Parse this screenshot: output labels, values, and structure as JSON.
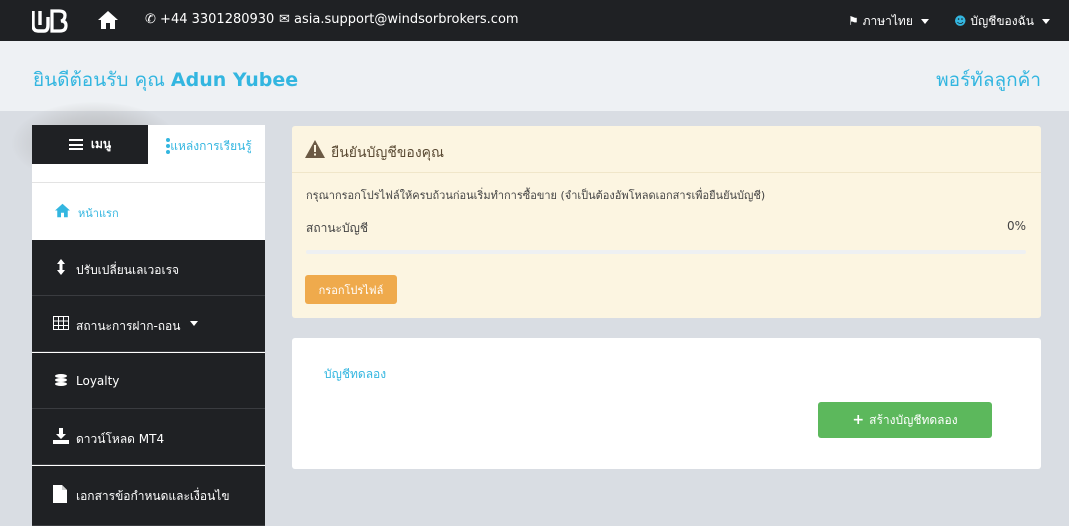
{
  "colors": {
    "accent": "#33b6e0",
    "navbar": "#1f2124",
    "warning_bg": "#fcf5e1",
    "warning_button": "#efaa4c",
    "success_button": "#5cb85c"
  },
  "navbar": {
    "logo_icon": "wb-logo",
    "home_icon": "home-icon",
    "phone": "+44 3301280930",
    "email": "asia.support@windsorbrokers.com",
    "language": "ภาษาไทย",
    "account": "บัญชีของฉัน"
  },
  "header": {
    "welcome_prefix": "ยินดีต้อนรับ คุณ",
    "user_name": "Adun Yubee",
    "portal_title": "พอร์ทัลลูกค้า"
  },
  "sidebar": {
    "menu_label": "เมนู",
    "learn_link": "แหล่งการเรียนรู้",
    "home_label": "หน้าแรก",
    "items": [
      {
        "label": "ปรับเปลี่ยนเลเวอเรจ",
        "icon": "arrows-vertical-icon"
      },
      {
        "label": "สถานะการฝาก-ถอน",
        "icon": "table-icon"
      },
      {
        "label": "Loyalty",
        "icon": "coins-icon"
      },
      {
        "label": "ดาวน์โหลด MT4",
        "icon": "download-icon"
      },
      {
        "label": "เอกสารข้อกำหนดและเงื่อนไข",
        "icon": "document-icon"
      }
    ]
  },
  "verify_panel": {
    "title": "ยืนยันบัญชีของคุณ",
    "description": "กรุณากรอกโปรไฟล์ให้ครบถ้วนก่อนเริ่มทำการซื้อขาย (จำเป็นต้องอัพโหลดเอกสารเพื่อยืนยันบัญชี)",
    "status_label": "สถานะบัญชี",
    "progress_text": "0%",
    "progress_value": 0,
    "button_label": "กรอกโปรไฟล์"
  },
  "demo_panel": {
    "title": "บัญชีทดลอง",
    "button_label": "สร้างบัญชีทดลอง"
  }
}
